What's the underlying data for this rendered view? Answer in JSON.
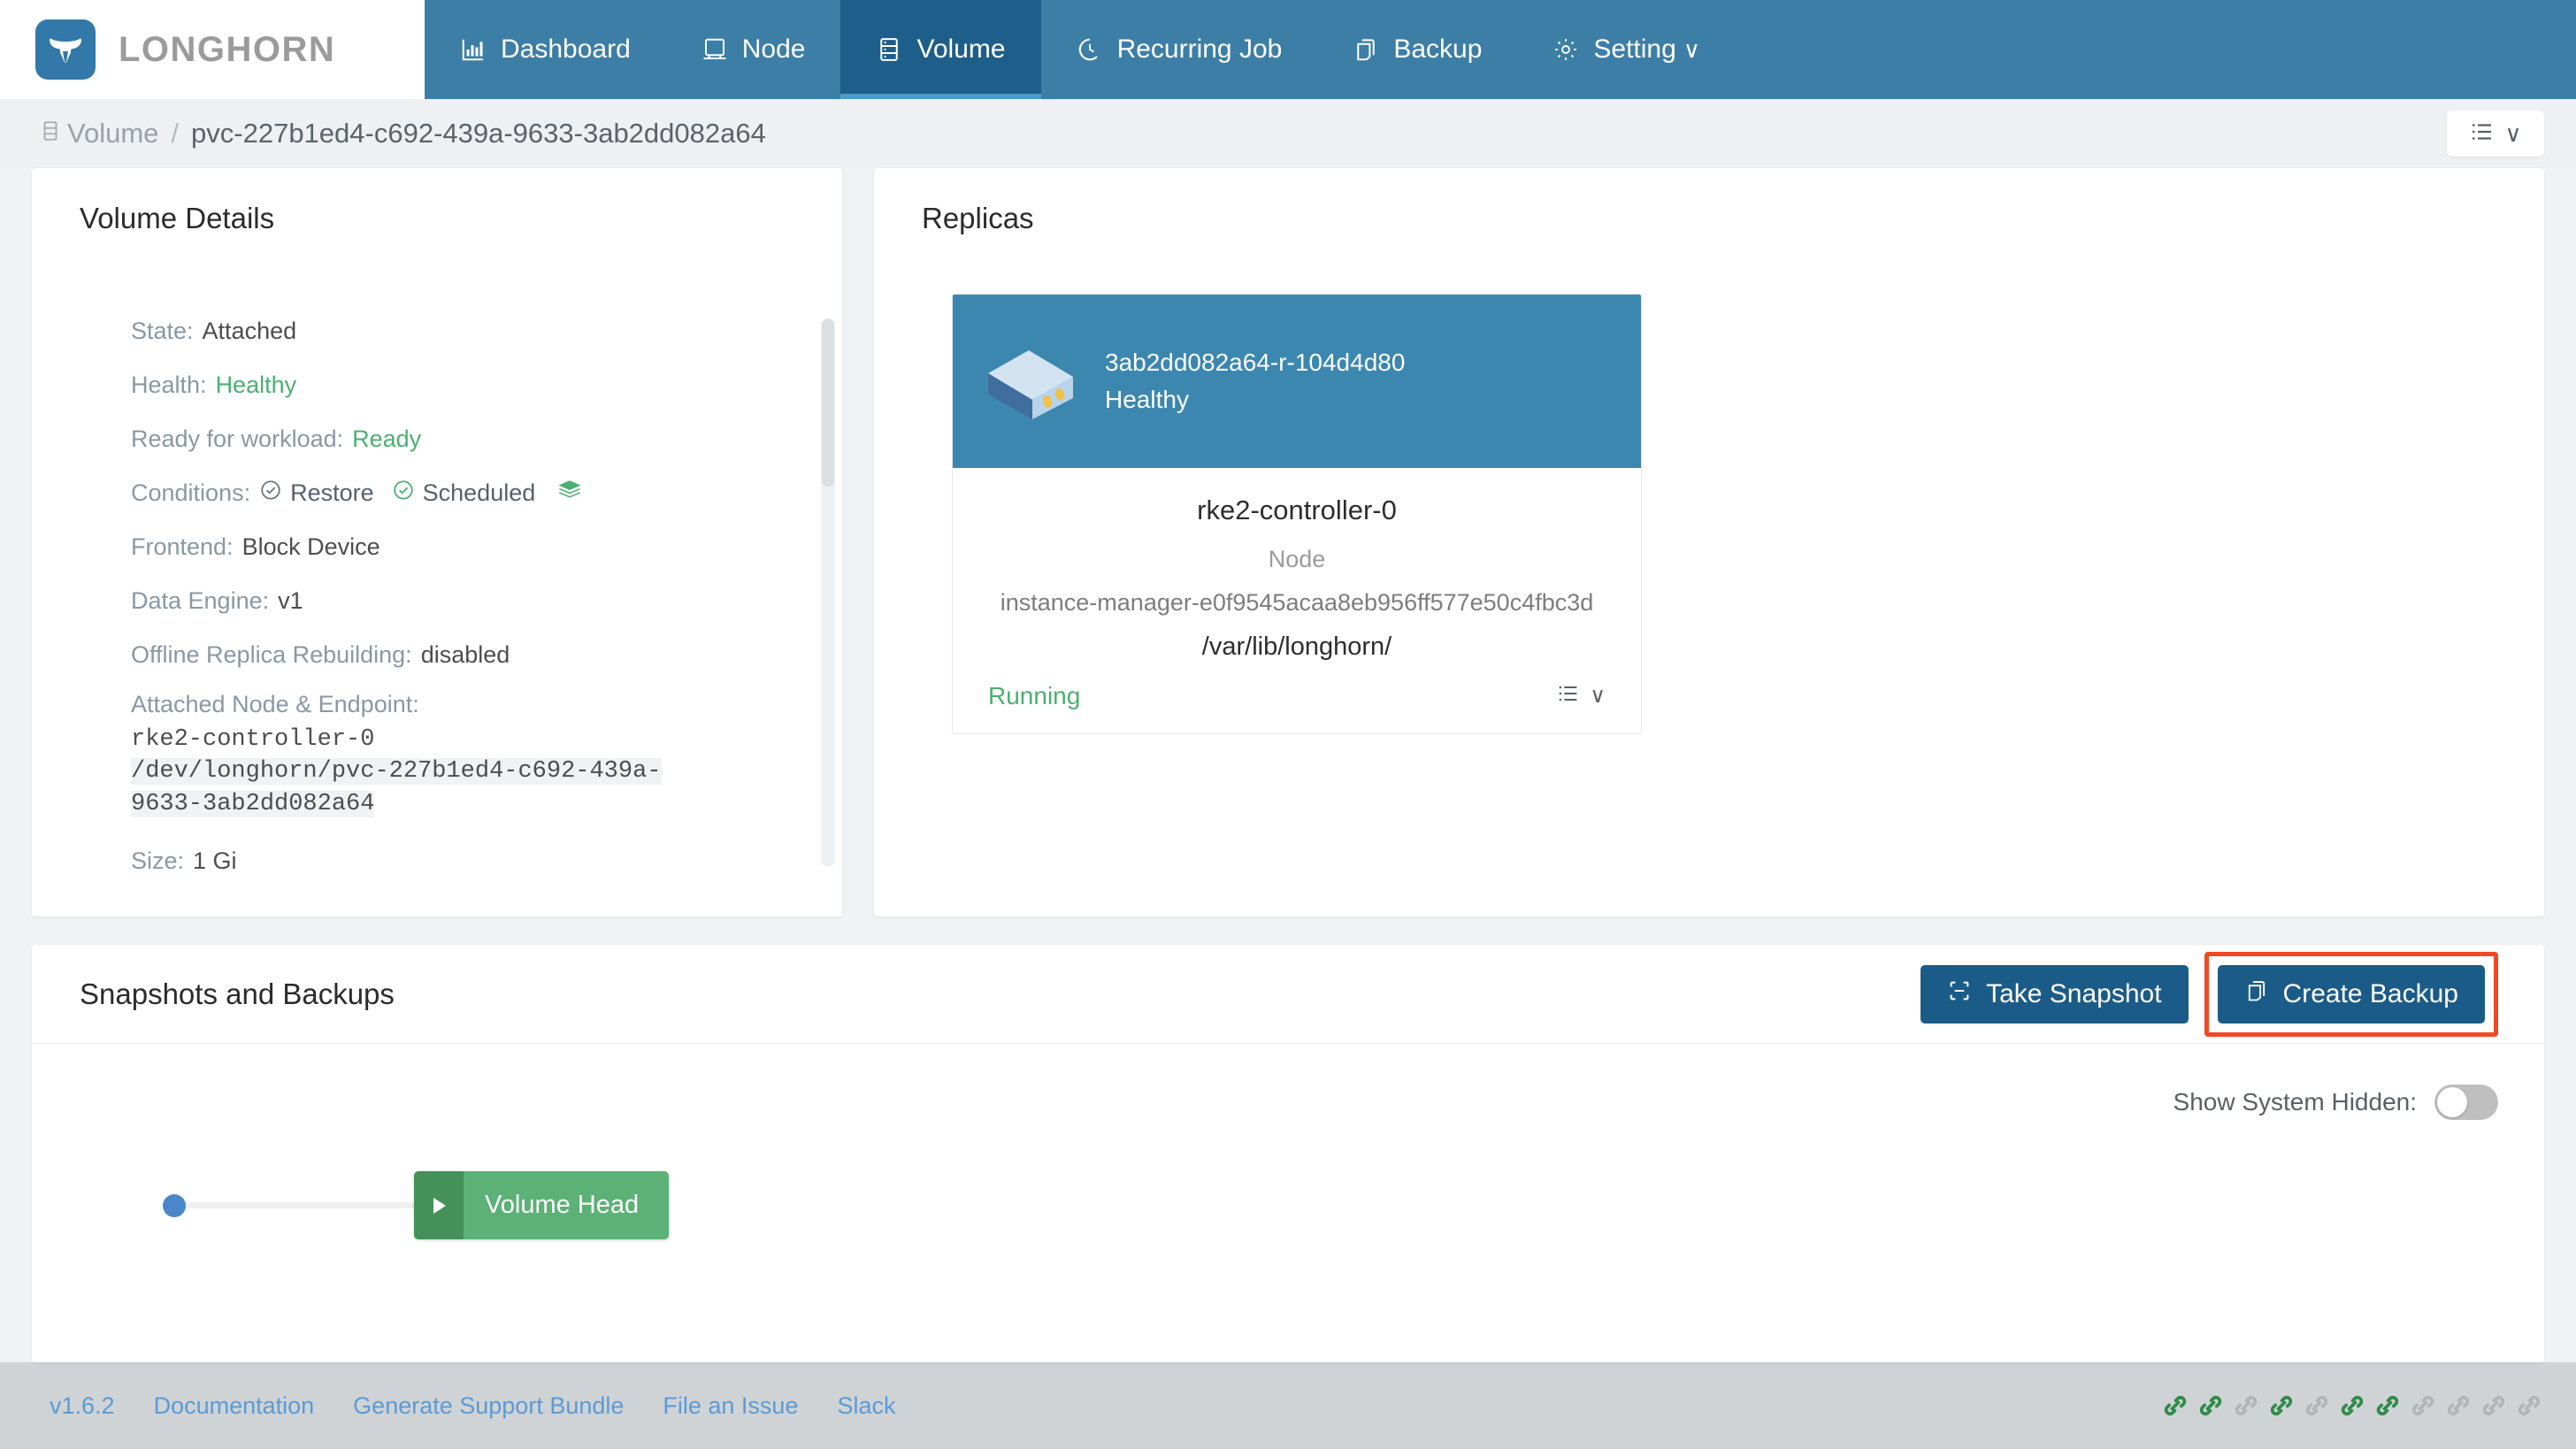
{
  "brand": {
    "name": "LONGHORN",
    "logo_icon": "longhorn-bull-icon"
  },
  "nav": {
    "items": [
      {
        "label": "Dashboard",
        "icon": "bar-chart-icon",
        "active": false
      },
      {
        "label": "Node",
        "icon": "server-rack-icon",
        "active": false
      },
      {
        "label": "Volume",
        "icon": "database-icon",
        "active": true
      },
      {
        "label": "Recurring Job",
        "icon": "clock-icon",
        "active": false
      },
      {
        "label": "Backup",
        "icon": "copy-icon",
        "active": false
      },
      {
        "label": "Setting",
        "icon": "gear-icon",
        "active": false,
        "caret": "∨"
      }
    ]
  },
  "breadcrumb": {
    "icon": "database-icon",
    "root": "Volume",
    "separator": "/",
    "current": "pvc-227b1ed4-c692-439a-9633-3ab2dd082a64"
  },
  "header_actions": {
    "list_menu_icon": "list-icon",
    "caret": "∨"
  },
  "volume_details": {
    "title": "Volume Details",
    "fields": [
      {
        "label": "State:",
        "value": "Attached",
        "style": "plain"
      },
      {
        "label": "Health:",
        "value": "Healthy",
        "style": "green"
      },
      {
        "label": "Ready for workload:",
        "value": "Ready",
        "style": "green"
      }
    ],
    "conditions": {
      "label": "Conditions:",
      "items": [
        {
          "text": "Restore",
          "check_color": "#6c757d"
        },
        {
          "text": "Scheduled",
          "check_color": "#4caf72"
        }
      ],
      "layers_icon": "layers-icon"
    },
    "fields2": [
      {
        "label": "Frontend:",
        "value": "Block Device"
      },
      {
        "label": "Data Engine:",
        "value": "v1"
      },
      {
        "label": "Offline Replica Rebuilding:",
        "value": "disabled"
      }
    ],
    "endpoint": {
      "label": "Attached Node & Endpoint:",
      "node": "rke2-controller-0",
      "path_line1": "/dev/longhorn/pvc-227b1ed4-c692-439a-",
      "path_line2": "9633-3ab2dd082a64"
    },
    "size": {
      "label": "Size:",
      "value": "1 Gi"
    }
  },
  "replicas": {
    "title": "Replicas",
    "items": [
      {
        "name": "3ab2dd082a64-r-104d4d80",
        "health": "Healthy",
        "disk_icon": "disk-block-icon",
        "node": "rke2-controller-0",
        "node_label": "Node",
        "instance_manager": "instance-manager-e0f9545acaa8eb956ff577e50c4fbc3d",
        "data_path": "/var/lib/longhorn/",
        "status": "Running",
        "menu_icon": "list-icon",
        "menu_caret": "∨"
      }
    ]
  },
  "snapshots": {
    "title": "Snapshots and Backups",
    "take_snapshot": {
      "label": "Take Snapshot",
      "icon": "crop-icon"
    },
    "create_backup": {
      "label": "Create Backup",
      "icon": "copy-icon",
      "highlighted": true
    },
    "show_system_hidden": {
      "label": "Show System Hidden:",
      "value": "off"
    },
    "timeline": {
      "volume_head_label": "Volume Head",
      "play_icon": "play-icon"
    }
  },
  "footer": {
    "links": [
      {
        "label": "v1.6.2"
      },
      {
        "label": "Documentation"
      },
      {
        "label": "Generate Support Bundle"
      },
      {
        "label": "File an Issue"
      },
      {
        "label": "Slack"
      }
    ],
    "chain_icons": [
      {
        "color": "#2e8b46"
      },
      {
        "color": "#2e8b46"
      },
      {
        "color": "#b0b5b8"
      },
      {
        "color": "#2e8b46"
      },
      {
        "color": "#b0b5b8"
      },
      {
        "color": "#2e8b46"
      },
      {
        "color": "#2e8b46"
      },
      {
        "color": "#b0b5b8"
      },
      {
        "color": "#b0b5b8"
      },
      {
        "color": "#b0b5b8"
      },
      {
        "color": "#b0b5b8"
      }
    ]
  },
  "colors": {
    "brand_blue": "#3c7ea6",
    "active_nav": "#1e5e8a",
    "button_blue": "#1b5b87",
    "green": "#4caf72",
    "highlight_red": "#f04a23",
    "replica_head": "#3c87b0"
  }
}
